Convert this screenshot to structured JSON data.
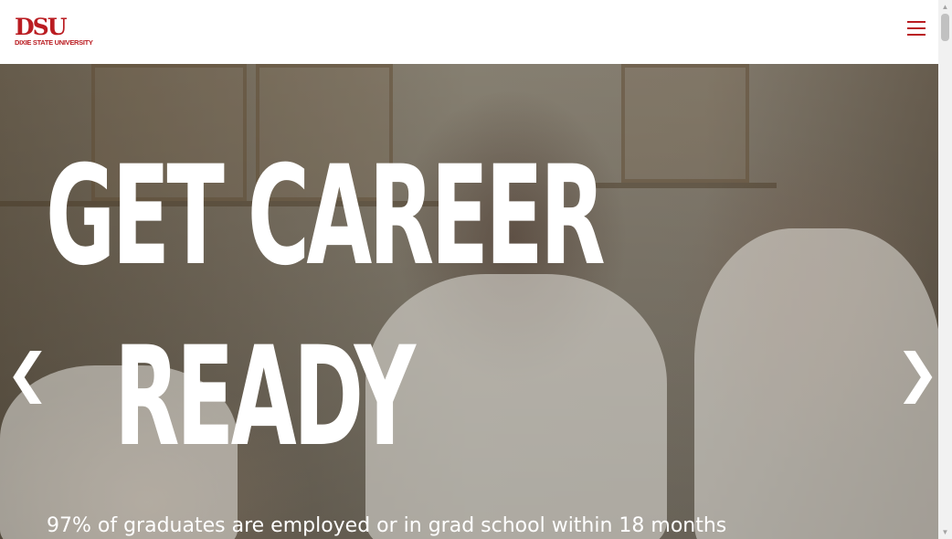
{
  "header": {
    "logo_mark": "DSU",
    "logo_text": "DIXIE STATE UNIVERSITY",
    "menu_icon": "hamburger-menu-icon",
    "accent_color": "#ba1c21"
  },
  "hero": {
    "headline_line1": "GET CAREER",
    "headline_line2": "READY",
    "subline": "97% of graduates are employed or in grad school within 18 months",
    "prev_arrow": "❮",
    "next_arrow": "❯"
  },
  "scrollbar": {
    "up_glyph": "▲",
    "down_glyph": "▼"
  }
}
